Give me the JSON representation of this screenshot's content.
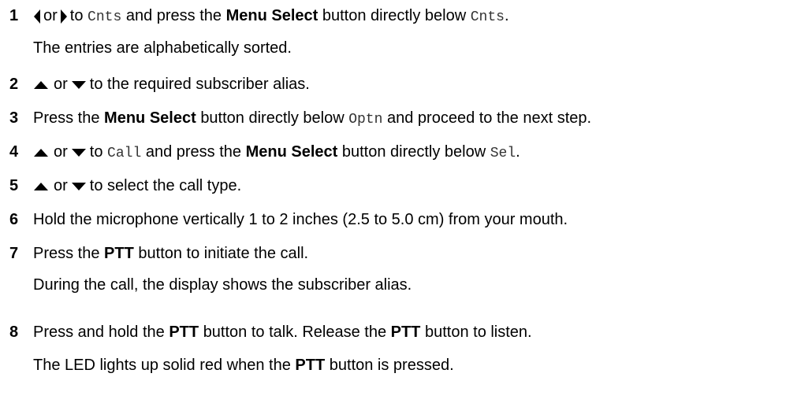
{
  "icons": {
    "left": "left-arrow-key-icon",
    "right": "right-arrow-key-icon",
    "up": "up-arrow-key-icon",
    "down": "down-arrow-key-icon"
  },
  "steps": [
    {
      "num": "1",
      "or": "or",
      "t1": "to",
      "c1": "Cnts",
      "t2": "and press the",
      "b1": "Menu Select",
      "t3": "button directly below",
      "c2": "Cnts",
      "t4": ".",
      "note": "The entries are alphabetically sorted."
    },
    {
      "num": "2",
      "or": "or",
      "t1": "to the required subscriber alias."
    },
    {
      "num": "3",
      "t1": "Press the",
      "b1": "Menu Select",
      "t2": "button directly below",
      "c1": "Optn",
      "t3": "and proceed to the next step."
    },
    {
      "num": "4",
      "or": "or",
      "t1": "to",
      "c1": "Call",
      "t2": "and press the",
      "b1": "Menu Select",
      "t3": "button directly below",
      "c2": "Sel",
      "t4": "."
    },
    {
      "num": "5",
      "or": "or",
      "t1": "to select the call type."
    },
    {
      "num": "6",
      "t1": "Hold the microphone vertically 1 to 2 inches (2.5 to 5.0 cm) from your mouth."
    },
    {
      "num": "7",
      "t1": "Press the",
      "b1": "PTT",
      "t2": "button to initiate the call.",
      "note": "During the call, the display shows the subscriber alias."
    },
    {
      "num": "8",
      "t1": "Press and hold the",
      "b1": "PTT",
      "t2": "button to talk. Release the",
      "b2": "PTT",
      "t3": "button to listen.",
      "note_a": "The LED lights up solid red when the",
      "note_b": "PTT",
      "note_c": "button is pressed."
    }
  ]
}
